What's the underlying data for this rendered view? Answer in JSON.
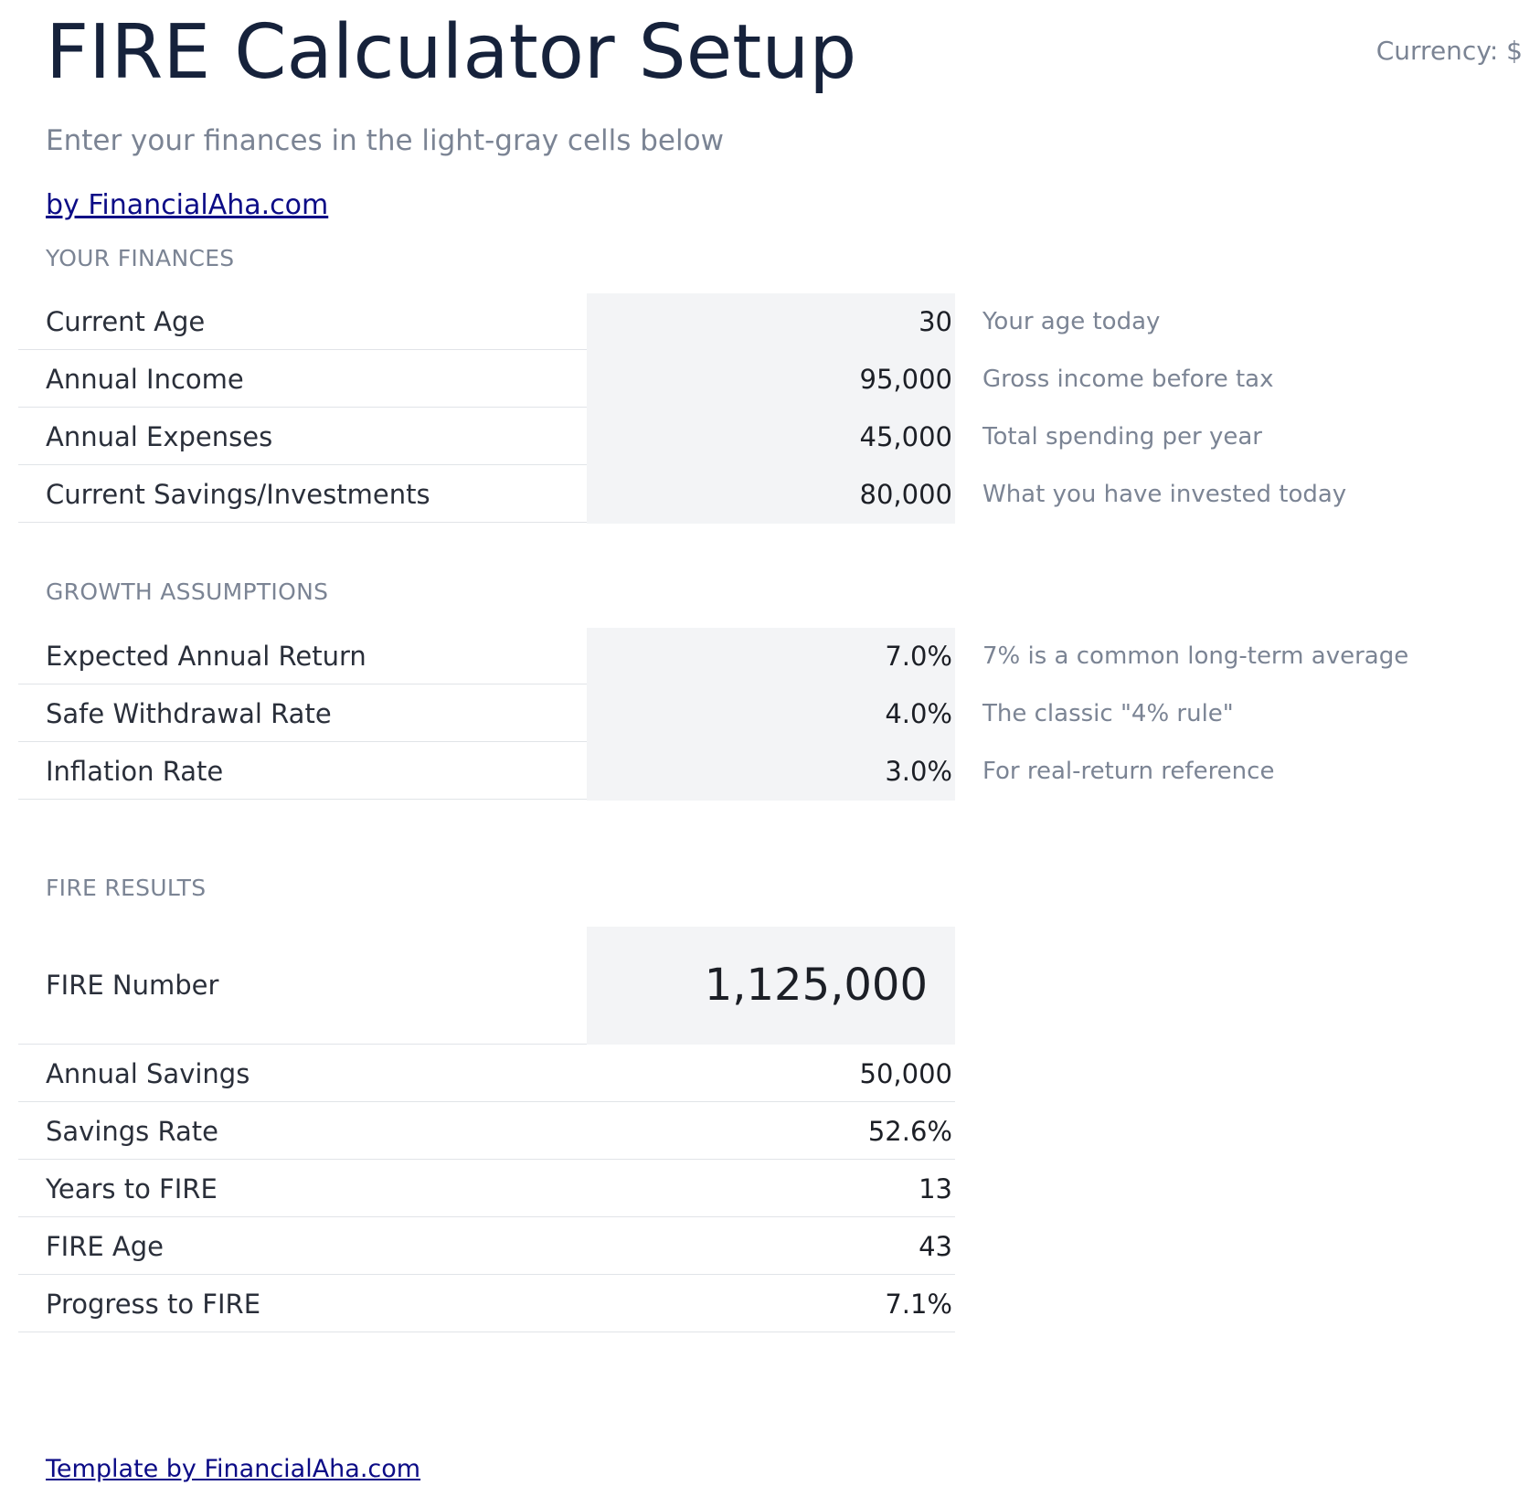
{
  "header": {
    "title": "FIRE Calculator Setup",
    "currency": "Currency: $",
    "subtitle": "Enter your finances in the light-gray cells below",
    "byline": "by FinancialAha.com"
  },
  "finances": {
    "heading": "YOUR FINANCES",
    "rows": [
      {
        "label": "Current Age",
        "value": "30",
        "note": "Your age today"
      },
      {
        "label": "Annual Income",
        "value": "95,000",
        "note": "Gross income before tax"
      },
      {
        "label": "Annual Expenses",
        "value": "45,000",
        "note": "Total spending per year"
      },
      {
        "label": "Current Savings/Investments",
        "value": "80,000",
        "note": "What you have invested today"
      }
    ]
  },
  "growth": {
    "heading": "GROWTH ASSUMPTIONS",
    "rows": [
      {
        "label": "Expected Annual Return",
        "value": "7.0%",
        "note": "7% is a common long-term average"
      },
      {
        "label": "Safe Withdrawal Rate",
        "value": "4.0%",
        "note": "The classic \"4% rule\""
      },
      {
        "label": "Inflation Rate",
        "value": "3.0%",
        "note": "For real-return reference"
      }
    ]
  },
  "results": {
    "heading": "FIRE RESULTS",
    "fire_number": {
      "label": "FIRE Number",
      "value": "1,125,000"
    },
    "rows": [
      {
        "label": "Annual Savings",
        "value": "50,000"
      },
      {
        "label": "Savings Rate",
        "value": "52.6%"
      },
      {
        "label": "Years to FIRE",
        "value": "13"
      },
      {
        "label": "FIRE Age",
        "value": "43"
      },
      {
        "label": "Progress to FIRE",
        "value": "7.1%"
      }
    ]
  },
  "footer": {
    "link": "Template by FinancialAha.com"
  }
}
